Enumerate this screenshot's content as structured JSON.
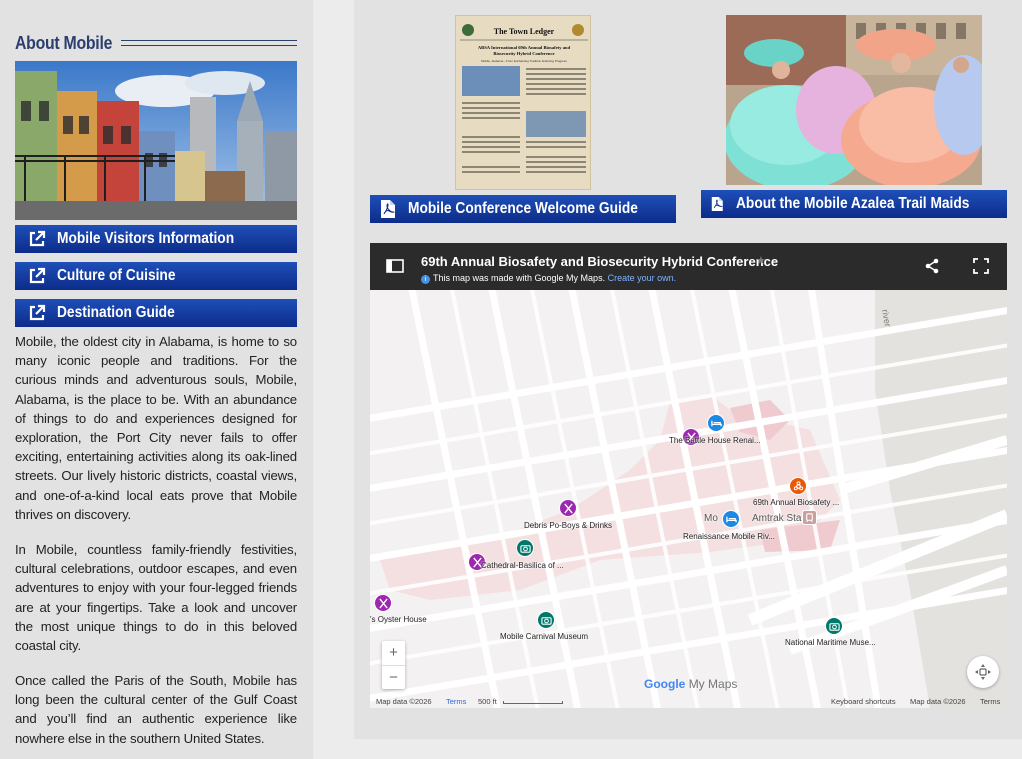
{
  "about": {
    "title": "About Mobile"
  },
  "sidebar": {
    "buttons": [
      {
        "label": "Mobile Visitors Information",
        "icon": "external-link-icon"
      },
      {
        "label": "Culture of Cuisine",
        "icon": "external-link-icon"
      },
      {
        "label": "Destination Guide",
        "icon": "external-link-icon"
      }
    ],
    "paragraphs": [
      "Mobile, the oldest city in Alabama, is home to so many iconic people and traditions. For the curious minds and adventurous souls, Mobile, Alabama, is the place to be. With an abundance of things to do and experiences designed for exploration, the Port City never fails to offer exciting, entertaining activities along its oak-lined streets. Our lively historic districts, coastal views, and one-of-a-kind local eats prove that Mobile thrives on discovery.",
      "In Mobile, countless family-friendly festivities, cultural celebrations, outdoor escapes, and even adventures to enjoy with your four-legged friends are at your fingertips. Take a look and uncover the most unique things to do in this beloved coastal city.",
      "Once called the Paris of the South, Mobile has long been the cultural center of the Gulf Coast and you’ll find an authentic experience like nowhere else in the southern United States."
    ]
  },
  "guides": {
    "welcome": {
      "label": "Mobile Conference Welcome Guide",
      "icon": "pdf-file-icon"
    },
    "azalea": {
      "label": "About the Mobile Azalea Trail Maids",
      "icon": "pdf-file-icon"
    }
  },
  "newspaper": {
    "masthead": "The Town Ledger",
    "headline": "ABSA International 69th Annual Biosafety and Biosecurity Hybrid Conference",
    "subhead": "Mobile, Alabama - From Enchanting Tradition Enduring Progress"
  },
  "map": {
    "title": "69th Annual Biosafety and Biosecurity Hybrid Conference",
    "made_with": "This map was made with Google My Maps.",
    "create_link": "Create your own.",
    "river_label": "river",
    "places": [
      {
        "label": "The Battle House Renai...",
        "type": "hotel"
      },
      {
        "label": "69th Annual Biosafety ...",
        "type": "venue"
      },
      {
        "label": "Renaissance Mobile Riv...",
        "type": "hotel"
      },
      {
        "label": "Amtrak Sta",
        "type": "station"
      },
      {
        "label": "Mo",
        "type": "area"
      },
      {
        "label": "Debris Po-Boys & Drinks",
        "type": "restaurant"
      },
      {
        "label": "Cathedral-Basilica of ...",
        "type": "restaurant"
      },
      {
        "label": "'s Oyster House",
        "type": "restaurant"
      },
      {
        "label": "Mobile Carnival Museum",
        "type": "museum"
      },
      {
        "label": "National Maritime Muse...",
        "type": "museum"
      }
    ],
    "zoom_in": "+",
    "zoom_out": "−",
    "brand_google": "Google",
    "brand_mymaps": "My Maps",
    "footer": {
      "data_left": "Map data ©2026",
      "terms_left": "Terms",
      "scale": "500 ft",
      "shortcuts": "Keyboard shortcuts",
      "data_right": "Map data ©2026",
      "terms_right": "Terms"
    }
  },
  "colors": {
    "button_blue": "#1f4fb8",
    "heading_navy": "#2b3f6e",
    "map_header": "#2b2b2b"
  }
}
